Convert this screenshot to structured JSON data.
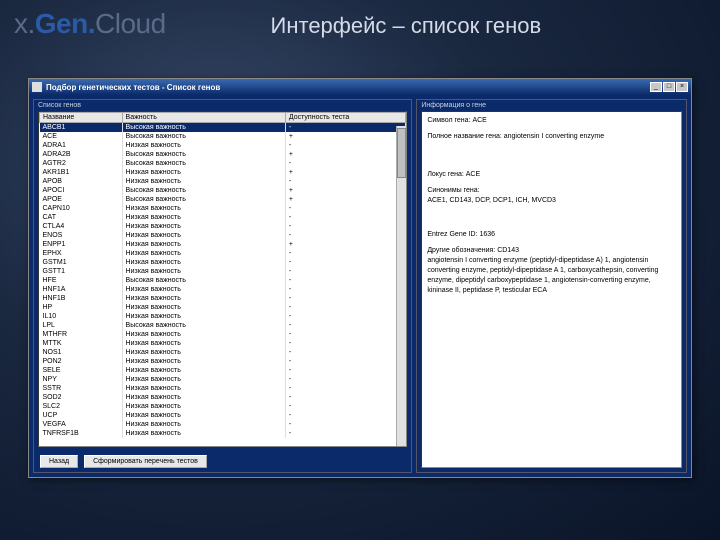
{
  "slide": {
    "logo_x": "x.",
    "logo_gen": "Gen.",
    "logo_cloud": "Cloud",
    "title": "Интерфейс – список генов"
  },
  "window": {
    "title": "Подбор генетических тестов - Список генов",
    "min": "_",
    "max": "□",
    "close": "×"
  },
  "left_panel": {
    "caption": "Список генов",
    "headers": {
      "name": "Название",
      "importance": "Важность",
      "avail": "Доступность теста"
    }
  },
  "genes": [
    {
      "n": "ABCB1",
      "i": "Высокая важность",
      "a": "-",
      "sel": true
    },
    {
      "n": "ACE",
      "i": "Высокая важность",
      "a": "+"
    },
    {
      "n": "ADRA1",
      "i": "Низкая важность",
      "a": "-"
    },
    {
      "n": "ADRA2B",
      "i": "Высокая важность",
      "a": "+"
    },
    {
      "n": "AGTR2",
      "i": "Высокая важность",
      "a": "-"
    },
    {
      "n": "AKR1B1",
      "i": "Низкая важность",
      "a": "+"
    },
    {
      "n": "APOB",
      "i": "Низкая важность",
      "a": "-"
    },
    {
      "n": "APOCI",
      "i": "Высокая важность",
      "a": "+"
    },
    {
      "n": "APOE",
      "i": "Высокая важность",
      "a": "+"
    },
    {
      "n": "CAPN10",
      "i": "Низкая важность",
      "a": "-"
    },
    {
      "n": "CAT",
      "i": "Низкая важность",
      "a": "-"
    },
    {
      "n": "CTLA4",
      "i": "Низкая важность",
      "a": "-"
    },
    {
      "n": "ENOS",
      "i": "Низкая важность",
      "a": "-"
    },
    {
      "n": "ENPP1",
      "i": "Низкая важность",
      "a": "+"
    },
    {
      "n": "EPHX",
      "i": "Низкая важность",
      "a": "-"
    },
    {
      "n": "GSTM1",
      "i": "Низкая важность",
      "a": "-"
    },
    {
      "n": "GSTT1",
      "i": "Низкая важность",
      "a": "-"
    },
    {
      "n": "HFE",
      "i": "Высокая важность",
      "a": "-"
    },
    {
      "n": "HNF1A",
      "i": "Низкая важность",
      "a": "-"
    },
    {
      "n": "HNF1B",
      "i": "Низкая важность",
      "a": "-"
    },
    {
      "n": "HP",
      "i": "Низкая важность",
      "a": "-"
    },
    {
      "n": "IL10",
      "i": "Низкая важность",
      "a": "-"
    },
    {
      "n": "LPL",
      "i": "Высокая важность",
      "a": "-"
    },
    {
      "n": "MTHFR",
      "i": "Низкая важность",
      "a": "-"
    },
    {
      "n": "MTTK",
      "i": "Низкая важность",
      "a": "-"
    },
    {
      "n": "NOS1",
      "i": "Низкая важность",
      "a": "-"
    },
    {
      "n": "PON2",
      "i": "Низкая важность",
      "a": "-"
    },
    {
      "n": "SELE",
      "i": "Низкая важность",
      "a": "-"
    },
    {
      "n": "NPY",
      "i": "Низкая важность",
      "a": "-"
    },
    {
      "n": "SSTR",
      "i": "Низкая важность",
      "a": "-"
    },
    {
      "n": "SOD2",
      "i": "Низкая важность",
      "a": "-"
    },
    {
      "n": "SLC2",
      "i": "Низкая важность",
      "a": "-"
    },
    {
      "n": "UCP",
      "i": "Низкая важность",
      "a": "-"
    },
    {
      "n": "VEGFA",
      "i": "Низкая важность",
      "a": "-"
    },
    {
      "n": "TNFRSF1B",
      "i": "Низкая важность",
      "a": "-"
    }
  ],
  "buttons": {
    "back": "Назад",
    "generate": "Сформировать перечень тестов"
  },
  "right_panel": {
    "caption": "Информация о гене",
    "symbol_label": "Символ гена: ACE",
    "fullname_label": "Полное название гена: angiotensin I converting enzyme",
    "locus_label": "Локус гена: ACE",
    "synonyms_label": "Синонимы гена:",
    "synonyms_value": "ACE1, CD143, DCP, DCP1, ICH, MVCD3",
    "entrez_label": "Entrez Gene ID: 1636",
    "other_label": "Другие обозначения: CD143",
    "other_value": "angiotensin I converting enzyme (peptidyl-dipeptidase A) 1, angiotensin converting enzyme, peptidyl-dipeptidase A 1, carboxycathepsin, converting enzyme, dipeptidyl carboxypeptidase 1, angiotensin-converting enzyme, kininase II, peptidase P, testicular ECA"
  }
}
